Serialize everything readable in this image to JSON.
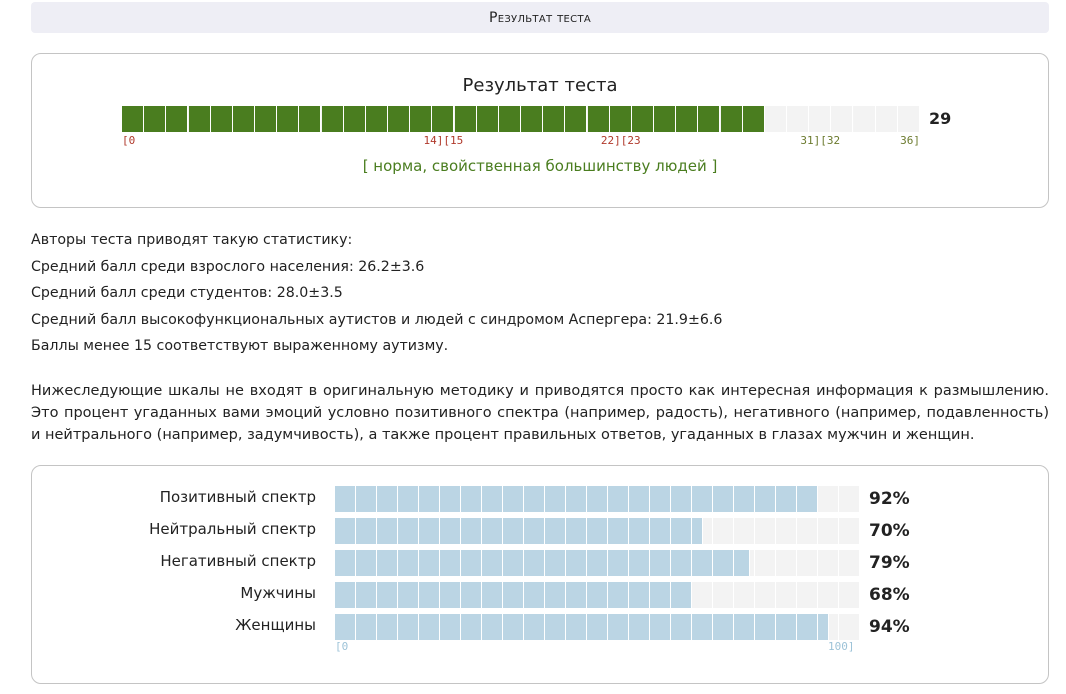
{
  "header": {
    "title": "Результат теста"
  },
  "result": {
    "title": "Результат теста",
    "score": 29,
    "max": 36,
    "score_label": "29",
    "fill_color": "#4a7d1f",
    "ticks": [
      {
        "label": "[0",
        "value": 0,
        "color": "#b0392b"
      },
      {
        "label": "14][15",
        "value": 14.5,
        "color": "#b0392b"
      },
      {
        "label": "22][23",
        "value": 22.5,
        "color": "#b0392b"
      },
      {
        "label": "31][32",
        "value": 31.5,
        "color": "#6b7a2e"
      },
      {
        "label": "36]",
        "value": 36,
        "color": "#6b7a2e"
      }
    ],
    "verdict": "[ норма, свойственная большинству людей ]",
    "verdict_color": "#4a7d1f"
  },
  "stats": {
    "lines": [
      "Авторы теста приводят такую статистику:",
      "Средний балл среди взрослого населения: 26.2±3.6",
      "Средний балл среди студентов: 28.0±3.5",
      "Средний балл высокофункциональных аутистов и людей с синдромом Аспергера: 21.9±6.6",
      "Баллы менее 15 соответствуют выраженному аутизму."
    ]
  },
  "note": {
    "text": "Нижеследующие шкалы не входят в оригинальную методику и приводятся просто как интересная информация к размышлению. Это процент угаданных вами эмоций условно позитивного спектра (например, радость), негативного (например, подавленность) и нейтрального (например, задумчивость), а также процент правильных ответов, угаданных в глазах мужчин и женщин."
  },
  "scales": {
    "fill_color": "#bbd5e4",
    "min_label": "[0",
    "max_label": "100]",
    "items": [
      {
        "label": "Позитивный спектр",
        "percent": 92,
        "value_label": "92%"
      },
      {
        "label": "Нейтральный спектр",
        "percent": 70,
        "value_label": "70%"
      },
      {
        "label": "Негативный спектр",
        "percent": 79,
        "value_label": "79%"
      },
      {
        "label": "Мужчины",
        "percent": 68,
        "value_label": "68%"
      },
      {
        "label": "Женщины",
        "percent": 94,
        "value_label": "94%"
      }
    ]
  }
}
